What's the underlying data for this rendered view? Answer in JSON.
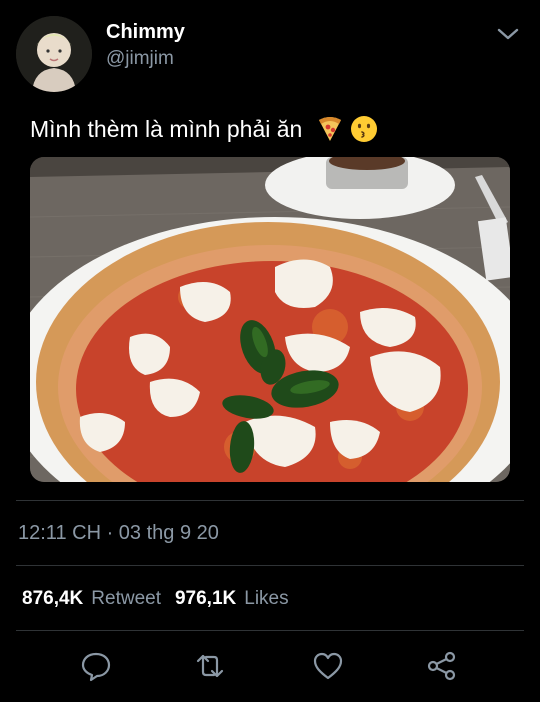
{
  "user": {
    "display_name": "Chimmy",
    "handle": "@jimjim"
  },
  "tweet": {
    "text": "Mình thèm là mình phải ăn",
    "emojis": [
      "pizza-emoji",
      "kissing-face-emoji"
    ]
  },
  "meta": {
    "timestamp": "12:11 CH · 03 thg 9 20"
  },
  "stats": {
    "retweets_count": "876,4K",
    "retweets_label": "Retweet",
    "likes_count": "976,1K",
    "likes_label": "Likes"
  },
  "actions": [
    "reply-icon",
    "retweet-icon",
    "like-icon",
    "share-icon"
  ],
  "colors": {
    "background": "#000000",
    "secondary_text": "#8b98a5",
    "divider": "#2f3336"
  }
}
